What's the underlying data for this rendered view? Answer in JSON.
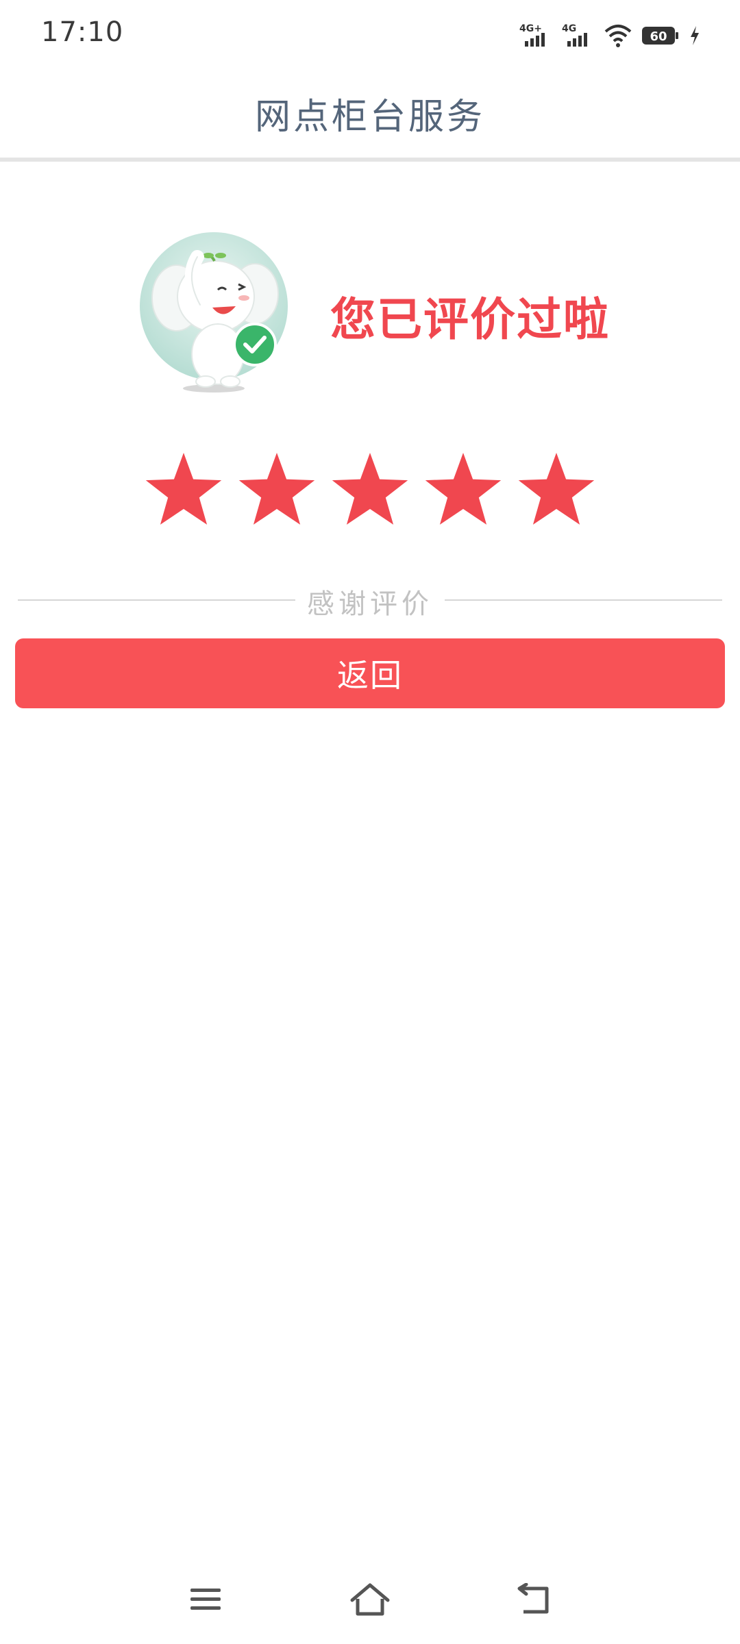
{
  "status_bar": {
    "time": "17:10",
    "network1": "4G+",
    "network2": "4G",
    "battery_level": "60"
  },
  "header": {
    "title": "网点柜台服务"
  },
  "result": {
    "message": "您已评价过啦",
    "rating": 5,
    "rating_max": 5,
    "mascot_icon": "elephant-mascot-check-icon"
  },
  "thanks": {
    "label": "感谢评价"
  },
  "actions": {
    "return_label": "返回"
  },
  "colors": {
    "accent": "#f0474f",
    "button": "#f85256",
    "title": "#54657a",
    "check": "#3ab56a"
  },
  "nav": {
    "menu_icon": "menu-icon",
    "home_icon": "home-icon",
    "back_icon": "back-icon"
  }
}
